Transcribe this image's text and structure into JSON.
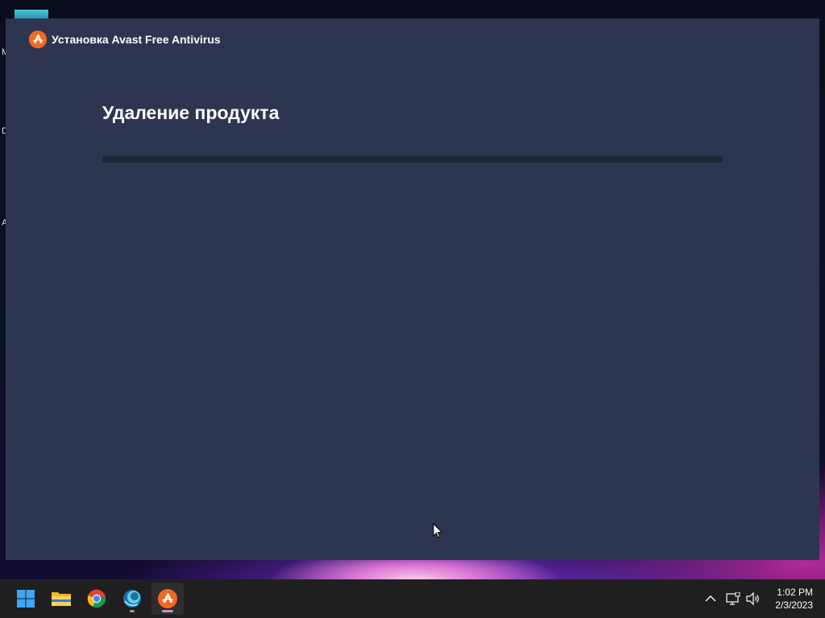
{
  "window": {
    "title": "Установка Avast Free Antivirus",
    "heading": "Удаление продукта",
    "progress_fraction": 0.0
  },
  "desktop": {
    "edge_letters": [
      "M",
      "D",
      "A"
    ]
  },
  "taskbar": {
    "pinned": [
      {
        "name": "start-button",
        "icon": "windows-logo-icon"
      },
      {
        "name": "file-explorer-button",
        "icon": "folder-icon"
      },
      {
        "name": "chrome-button",
        "icon": "chrome-icon"
      },
      {
        "name": "app-button",
        "icon": "globe-app-icon"
      },
      {
        "name": "avast-taskbar-button",
        "icon": "avast-icon"
      }
    ],
    "tray": {
      "icons": [
        "chevron-up-icon",
        "network-icon",
        "volume-icon"
      ]
    },
    "clock": {
      "time": "1:02 PM",
      "date": "2/3/2023"
    }
  },
  "colors": {
    "window_bg": "#2e3550",
    "accent": "#f26a21",
    "taskbar_bg": "#1f1f1f"
  }
}
